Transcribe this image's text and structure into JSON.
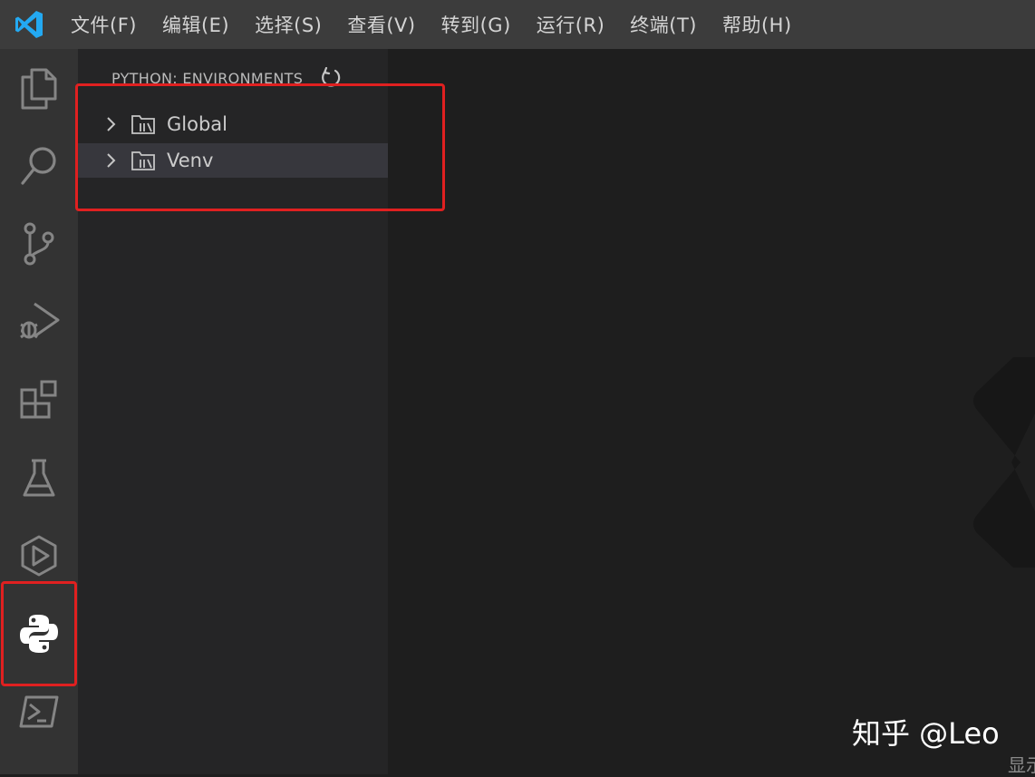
{
  "menubar": {
    "items": [
      "文件(F)",
      "编辑(E)",
      "选择(S)",
      "查看(V)",
      "转到(G)",
      "运行(R)",
      "终端(T)",
      "帮助(H)"
    ]
  },
  "activitybar": {
    "icons": [
      "explorer-icon",
      "search-icon",
      "source-control-icon",
      "run-debug-icon",
      "extensions-icon",
      "testing-icon",
      "remote-explorer-icon",
      "python-icon",
      "powershell-icon"
    ],
    "active": "python-icon"
  },
  "sidebar": {
    "title": "PYTHON: ENVIRONMENTS",
    "tree": [
      {
        "label": "Global"
      },
      {
        "label": "Venv"
      }
    ]
  },
  "watermark": {
    "credit": "知乎 @Leo",
    "status_fragment": "显示"
  },
  "colors": {
    "menubar_bg": "#3c3c3c",
    "activitybar_bg": "#333333",
    "sidebar_bg": "#252526",
    "editor_bg": "#1e1e1e",
    "annotation": "#e02020",
    "vscode_blue": "#23a9f2"
  }
}
